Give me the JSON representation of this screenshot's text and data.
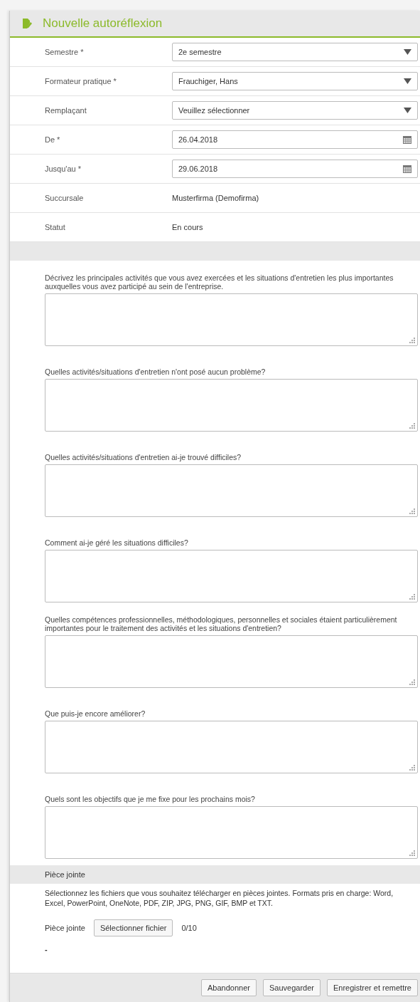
{
  "panel": {
    "title": "Nouvelle autoréflexion"
  },
  "fields": [
    {
      "label": "Semestre *",
      "kind": "select",
      "value": "2e semestre"
    },
    {
      "label": "Formateur pratique *",
      "kind": "select",
      "value": "Frauchiger, Hans"
    },
    {
      "label": "Remplaçant",
      "kind": "select",
      "value": "Veuillez sélectionner"
    },
    {
      "label": "De *",
      "kind": "date",
      "value": "26.04.2018"
    },
    {
      "label": "Jusqu'au *",
      "kind": "date",
      "value": "29.06.2018"
    },
    {
      "label": "Succursale",
      "kind": "text",
      "value": "Musterfirma (Demofirma)"
    },
    {
      "label": "Statut",
      "kind": "text",
      "value": "En cours"
    }
  ],
  "questions": [
    {
      "label": "Décrivez les principales activités que vous avez exercées et les situations d'entretien les plus importantes auxquelles vous avez participé au sein de l'entreprise."
    },
    {
      "label": "Quelles activités/situations d'entretien n'ont posé aucun problème?"
    },
    {
      "label": "Quelles activités/situations d'entretien ai-je trouvé difficiles?"
    },
    {
      "label": "Comment ai-je géré les situations difficiles?"
    },
    {
      "label": "Quelles compétences professionnelles, méthodologiques, personnelles et sociales étaient particulièrement importantes pour le traitement des activités et les situations d'entretien?"
    },
    {
      "label": "Que puis-je encore améliorer?"
    },
    {
      "label": "Quels sont les objectifs que je me fixe pour les prochains mois?"
    }
  ],
  "attachment": {
    "heading": "Pièce jointe",
    "description": "Sélectionnez les fichiers que vous souhaitez télécharger en pièces jointes. Formats pris en charge: Word, Excel, PowerPoint, OneNote, PDF, ZIP, JPG, PNG, GIF, BMP et TXT.",
    "label": "Pièce jointe",
    "button": "Sélectionner fichier",
    "count": "0/10",
    "files": "-"
  },
  "buttons": [
    "Abandonner",
    "Sauvegarder",
    "Enregistrer et remettre"
  ]
}
